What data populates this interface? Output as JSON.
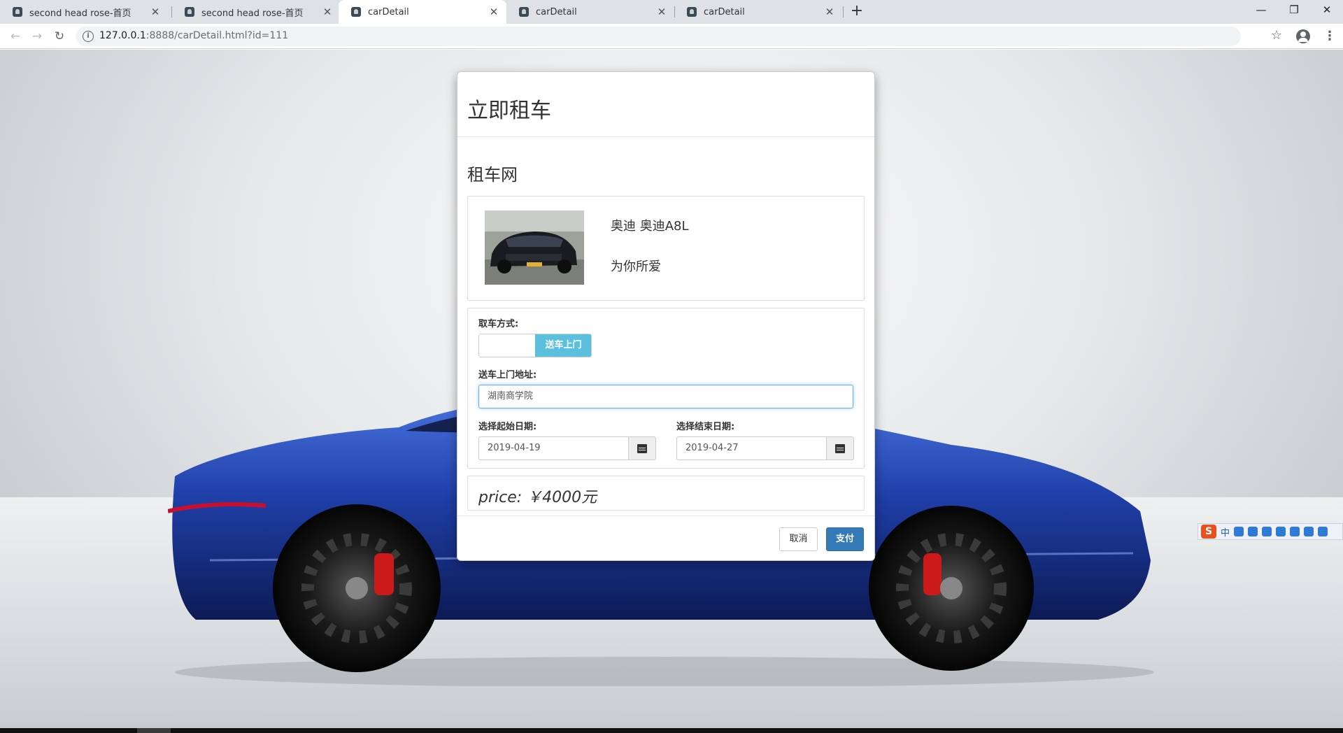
{
  "browser": {
    "tabs": [
      {
        "title": "second head rose-首页",
        "active": false
      },
      {
        "title": "second head rose-首页",
        "active": false
      },
      {
        "title": "carDetail",
        "active": true
      },
      {
        "title": "carDetail",
        "active": false
      },
      {
        "title": "carDetail",
        "active": false
      }
    ],
    "url_host": "127.0.0.1",
    "url_rest": ":8888/carDetail.html?id=111"
  },
  "modal": {
    "title": "立即租车",
    "site_name": "租车网",
    "car": {
      "name": "奥迪 奥迪A8L",
      "slogan": "为你所爱"
    },
    "form": {
      "pickup_label": "取车方式:",
      "pickup_option": "送车上门",
      "address_label": "送车上门地址:",
      "address_value": "湖南商学院",
      "start_date_label": "选择起始日期:",
      "start_date_value": "2019-04-19",
      "end_date_label": "选择结束日期:",
      "end_date_value": "2019-04-27"
    },
    "price_text": "price: ￥4000元",
    "buttons": {
      "cancel": "取消",
      "pay": "支付"
    }
  },
  "ime": {
    "logo": "S",
    "mode": "中"
  },
  "colors": {
    "primary": "#337ab7",
    "info": "#5bc0de",
    "car_blue": "#1f3fa8"
  }
}
